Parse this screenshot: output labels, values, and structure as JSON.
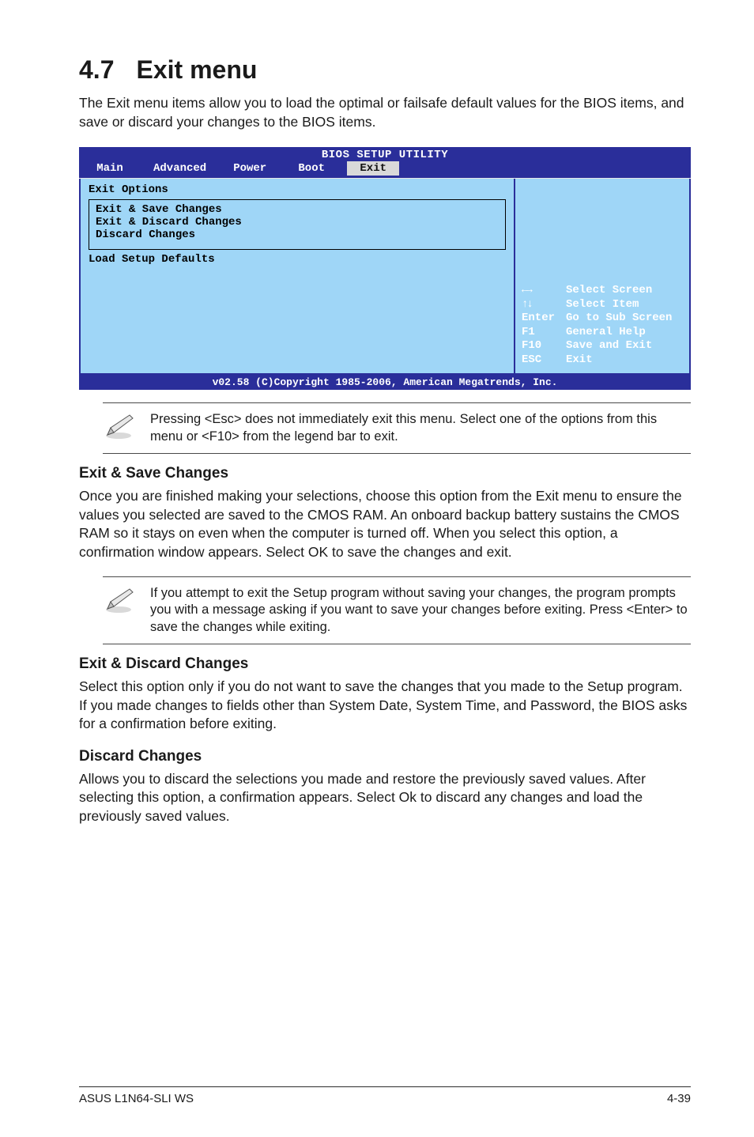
{
  "section": {
    "number": "4.7",
    "title": "Exit menu"
  },
  "lead": "The Exit menu items allow you to load the optimal or failsafe default values for the BIOS items, and save or discard your changes to the BIOS items.",
  "bios": {
    "title": "BIOS SETUP UTILITY",
    "tabs": [
      "Main",
      "Advanced",
      "Power",
      "Boot",
      "Exit"
    ],
    "active_tab": 4,
    "left": {
      "heading": "Exit Options",
      "box": [
        "Exit & Save Changes",
        "Exit & Discard Changes",
        "Discard Changes"
      ],
      "after": "Load Setup Defaults"
    },
    "legend": [
      {
        "key_glyph": "arrows",
        "label": "Select Screen"
      },
      {
        "key_glyph": "updown",
        "label": "Select Item"
      },
      {
        "key": "Enter",
        "label": "Go to Sub Screen"
      },
      {
        "key": "F1",
        "label": "General Help"
      },
      {
        "key": "F10",
        "label": "Save and Exit"
      },
      {
        "key": "ESC",
        "label": "Exit"
      }
    ],
    "footer": "v02.58 (C)Copyright 1985-2006, American Megatrends, Inc."
  },
  "note1": "Pressing <Esc> does not immediately exit this menu. Select one of the options from this menu or <F10> from the legend bar to exit.",
  "sub1": {
    "title": "Exit & Save Changes",
    "body": "Once you are finished making your selections, choose this option from the Exit menu to ensure the values you selected are saved to the CMOS RAM. An onboard backup battery sustains the CMOS RAM so it stays on even when the computer is turned off. When you select this option, a confirmation window appears. Select OK to save the changes and exit."
  },
  "note2": " If you attempt to exit the Setup program without saving your changes, the program prompts you with a message asking if you want to save your changes before exiting. Press <Enter>  to save the  changes while exiting.",
  "sub2": {
    "title": "Exit & Discard Changes",
    "body": "Select this option only if you do not want to save the changes that you  made to the Setup program. If you made changes to fields other than System Date, System Time, and Password, the BIOS asks for a confirmation before exiting."
  },
  "sub3": {
    "title": "Discard Changes",
    "body": "Allows you to discard the selections you made and restore the previously saved values. After selecting this option, a confirmation appears. Select Ok to discard any changes and load the previously saved values."
  },
  "footer": {
    "left": "ASUS L1N64-SLI WS",
    "right": "4-39"
  }
}
